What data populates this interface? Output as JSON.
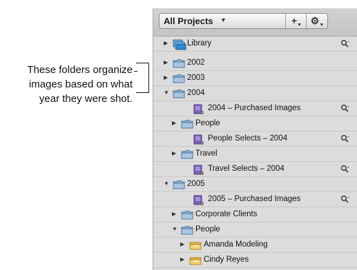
{
  "callout": {
    "lines": [
      "These folders organize",
      "images based on what",
      "year they were shot."
    ]
  },
  "header": {
    "title": "All Projects",
    "add_label": "+",
    "gear_label": "⚙"
  },
  "tree": [
    {
      "label": "Library",
      "icon": "library-icon",
      "arrow": "▶",
      "mag": true
    },
    {
      "label": "2002",
      "icon": "folder-icon",
      "arrow": "▶",
      "mag": false
    },
    {
      "label": "2003",
      "icon": "folder-icon",
      "arrow": "▶",
      "mag": false
    },
    {
      "label": "2004",
      "icon": "folder-icon",
      "arrow": "▼",
      "mag": false
    },
    {
      "label": "2004 – Purchased Images",
      "icon": "project-icon",
      "arrow": "",
      "mag": true
    },
    {
      "label": "People",
      "icon": "folder-icon",
      "arrow": "▶",
      "mag": false
    },
    {
      "label": "People Selects – 2004",
      "icon": "project-icon",
      "arrow": "",
      "mag": true
    },
    {
      "label": "Travel",
      "icon": "folder-icon",
      "arrow": "▶",
      "mag": false
    },
    {
      "label": "Travel Selects – 2004",
      "icon": "project-icon",
      "arrow": "",
      "mag": true
    },
    {
      "label": "2005",
      "icon": "folder-icon",
      "arrow": "▼",
      "mag": false
    },
    {
      "label": "2005 – Purchased Images",
      "icon": "project-icon",
      "arrow": "",
      "mag": true
    },
    {
      "label": "Corporate Clients",
      "icon": "folder-icon",
      "arrow": "▶",
      "mag": false
    },
    {
      "label": "People",
      "icon": "folder-icon",
      "arrow": "▼",
      "mag": false
    },
    {
      "label": "Amanda Modeling",
      "icon": "project-box-icon",
      "arrow": "▶",
      "mag": false
    },
    {
      "label": "Cindy Reyes",
      "icon": "project-box-icon",
      "arrow": "▶",
      "mag": false
    }
  ]
}
